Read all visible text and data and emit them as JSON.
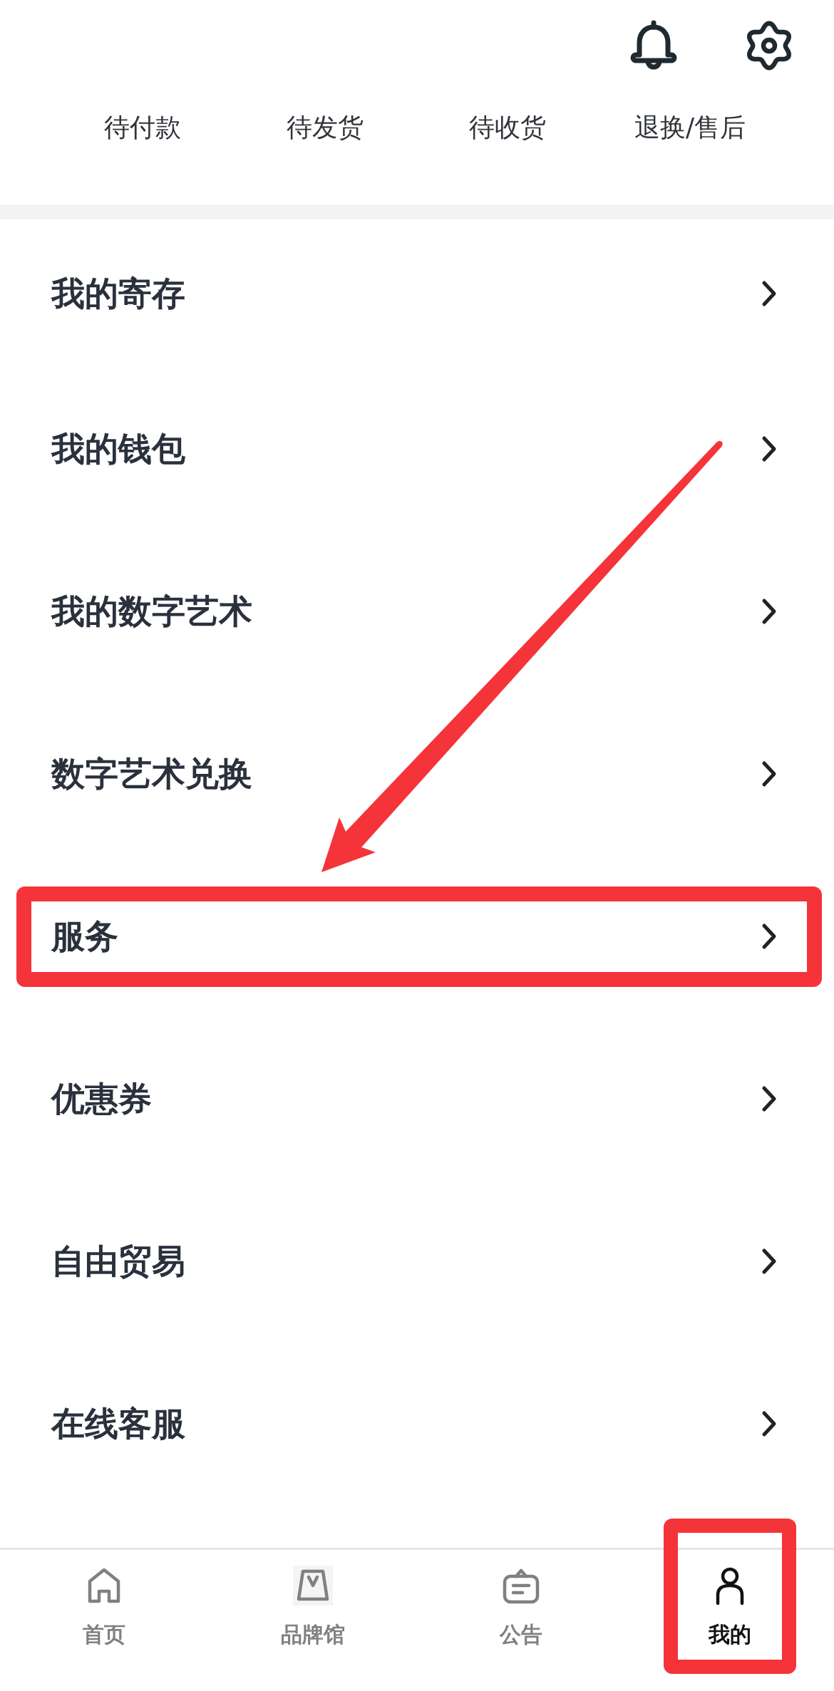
{
  "order_status": [
    {
      "label": "待付款"
    },
    {
      "label": "待发货"
    },
    {
      "label": "待收货"
    },
    {
      "label": "退换/售后"
    }
  ],
  "menu": [
    {
      "label": "我的寄存",
      "highlighted": false
    },
    {
      "label": "我的钱包",
      "highlighted": false
    },
    {
      "label": "我的数字艺术",
      "highlighted": false
    },
    {
      "label": "数字艺术兑换",
      "highlighted": false
    },
    {
      "label": "服务",
      "highlighted": true
    },
    {
      "label": "优惠券",
      "highlighted": false
    },
    {
      "label": "自由贸易",
      "highlighted": false
    },
    {
      "label": "在线客服",
      "highlighted": false
    }
  ],
  "tab_bar": [
    {
      "label": "首页",
      "selected": false,
      "highlighted": false
    },
    {
      "label": "品牌馆",
      "selected": false,
      "highlighted": false
    },
    {
      "label": "公告",
      "selected": false,
      "highlighted": false
    },
    {
      "label": "我的",
      "selected": true,
      "highlighted": true
    }
  ]
}
